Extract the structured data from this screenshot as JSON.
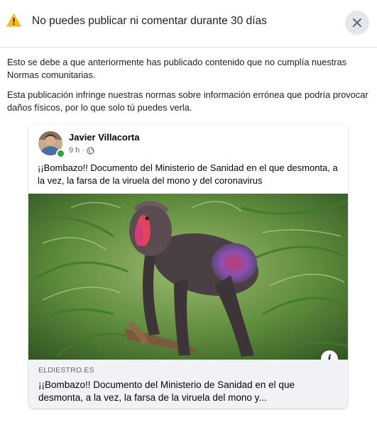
{
  "header": {
    "title": "No puedes publicar ni comentar durante 30 días",
    "warning_icon": "warning-triangle-icon",
    "warning_color": "#F7B928",
    "close_icon": "close-icon"
  },
  "messages": {
    "line1": "Esto se debe a que anteriormente has publicado contenido que no cumplía nuestras Normas comunitarias.",
    "line2": "Esta publicación infringe nuestras normas sobre información errónea que podría provocar daños físicos, por lo que solo tú puedes verla."
  },
  "post": {
    "author": "Javier Villacorta",
    "time": "9 h",
    "separator": "·",
    "privacy_icon": "globe-icon",
    "online_status_color": "#31A24C",
    "text": "¡¡Bombazo!! Documento del Ministerio de Sanidad en el que desmonta, a la vez, la farsa de la viruela del mono y del coronavirus",
    "image": "mandrill-photo",
    "info_icon": "info-icon",
    "link": {
      "domain": "ELDIESTRO.ES",
      "title": "¡¡Bombazo!! Documento del Ministerio de Sanidad en el que desmonta, a la vez, la farsa de la viruela del mono y..."
    }
  }
}
